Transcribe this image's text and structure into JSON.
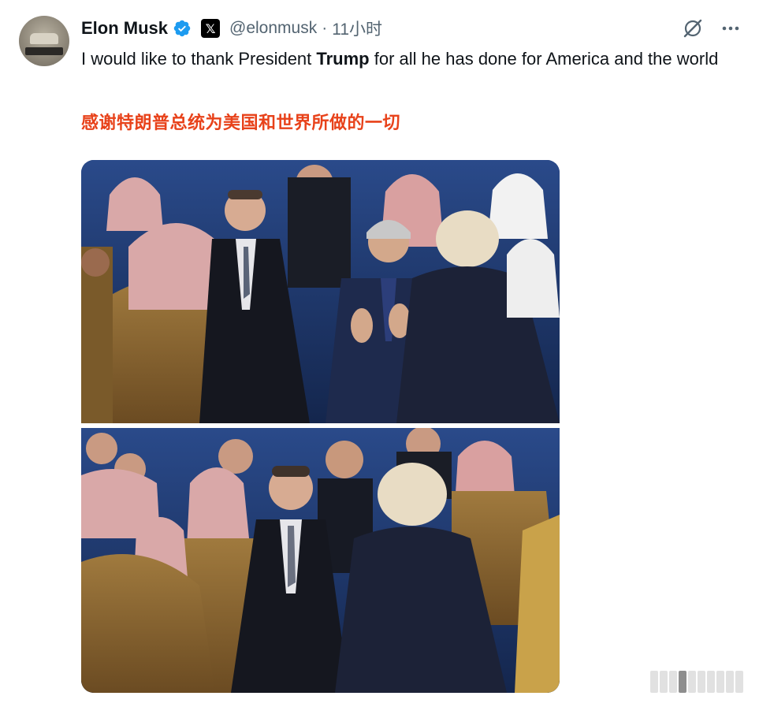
{
  "author": {
    "name": "Elon Musk",
    "handle": "@elonmusk",
    "separator": "·",
    "time": "11小时"
  },
  "icons": {
    "verified": "verified-badge-icon",
    "affiliate": "x-logo-icon",
    "grok": "grok-icon",
    "more": "more-icon"
  },
  "affiliate_glyph": "𝕏",
  "tweet": {
    "text_before": "I would like to thank President ",
    "text_bold": "Trump",
    "text_after": " for all he has done for America and the world",
    "translation": "感谢特朗普总统为美国和世界所做的一切"
  },
  "colors": {
    "verified": "#1d9bf0",
    "translation": "#e8421a",
    "secondary_text": "#536471"
  }
}
